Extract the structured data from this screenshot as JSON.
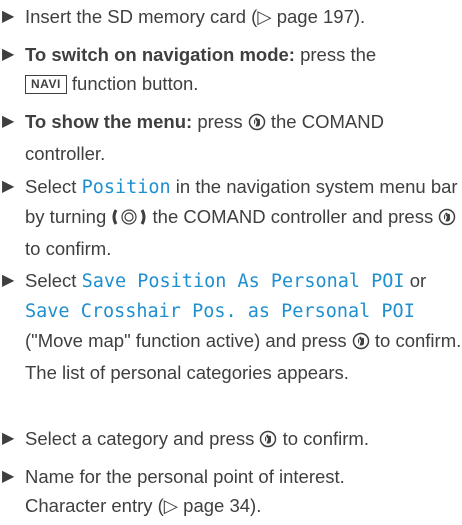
{
  "steps": [
    {
      "text1": "Insert the SD memory card (",
      "pageref": "▷ page 197",
      "text2": ")."
    },
    {
      "bold": "To switch on navigation mode:",
      "text1": " press the",
      "key": "NAVI",
      "text2": " function button."
    },
    {
      "bold": "To show the menu:",
      "text1": " press ",
      "text2": " the COMAND controller."
    },
    {
      "text1": "Select ",
      "mono1": "Position",
      "text2": " in the navigation system menu bar by turning ",
      "text3": " the COMAND controller and press ",
      "text4": " to confirm."
    },
    {
      "text1": "Select ",
      "mono1": "Save Position As Personal POI",
      "text2": " or ",
      "mono2": "Save Crosshair Pos. as Personal POI",
      "text3": " (\"Move map\" function active) and press ",
      "text4": " to confirm.",
      "note": "The list of personal categories appears."
    },
    {
      "text1": "Select a category and press ",
      "text2": " to confirm."
    },
    {
      "text1": "Name for the personal point of interest.",
      "text2": "Character entry (",
      "pageref": "▷ page 34",
      "text3": ")."
    }
  ],
  "bullet_glyph": "▶",
  "icons": [
    "press-controller-icon",
    "turn-controller-icon"
  ]
}
